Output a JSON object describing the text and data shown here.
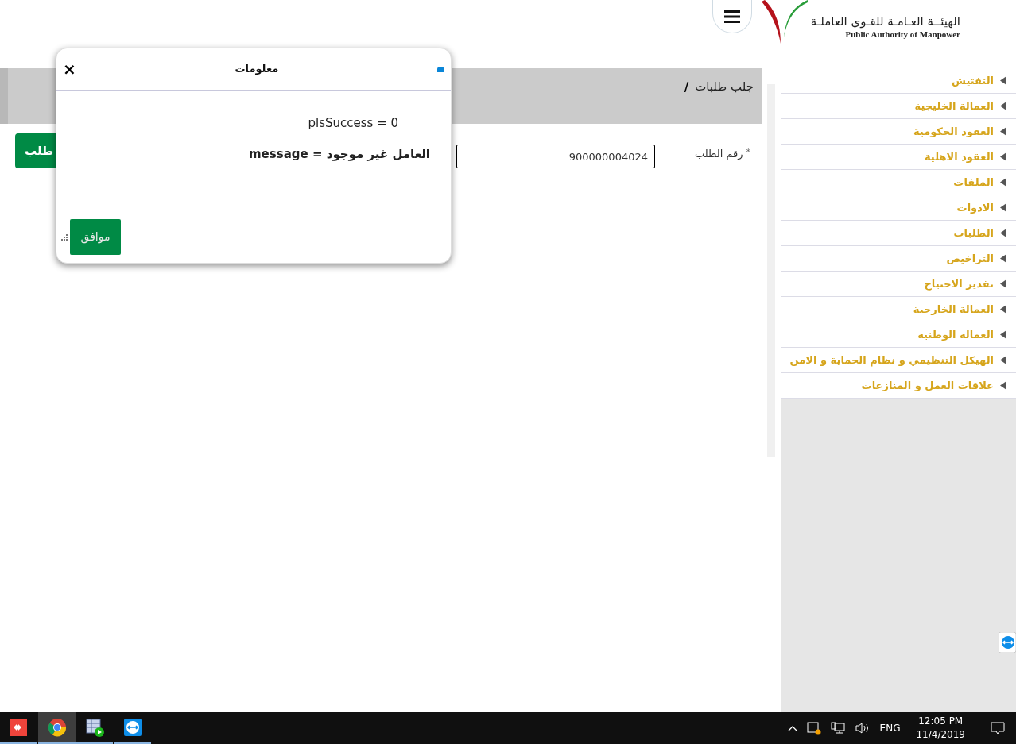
{
  "header": {
    "logo_arabic": "الهيئــة العـامـة للقـوى العاملـة",
    "logo_english": "Public Authority of Manpower"
  },
  "breadcrumb": {
    "title": "جلب طلبات",
    "separator": "/"
  },
  "form": {
    "label": "رقم الطلب",
    "required_mark": "*",
    "value": "900000004024",
    "button": "طلب"
  },
  "sidebar": {
    "items": [
      {
        "label": "التفتيش"
      },
      {
        "label": "العمالة الخليجية"
      },
      {
        "label": "العقود الحكومية"
      },
      {
        "label": "العقود الاهلية"
      },
      {
        "label": "الملفات"
      },
      {
        "label": "الادوات"
      },
      {
        "label": "الطلبات"
      },
      {
        "label": "التراخيص"
      },
      {
        "label": "تقدير الاحتياج"
      },
      {
        "label": "العمالة الخارجية"
      },
      {
        "label": "العمالة الوطنية"
      },
      {
        "label": "الهيكل التنظيمي و نظام الحماية و الامن"
      },
      {
        "label": "علاقات العمل و المنازعات"
      }
    ]
  },
  "dialog": {
    "title": "معلومات",
    "close": "×",
    "lines": [
      "plsSuccess = 0",
      "message = العامل غير موجود"
    ],
    "ok_button": "موافق"
  },
  "taskbar": {
    "time": "12:05 PM",
    "date": "11/4/2019",
    "language": "ENG",
    "apps": [
      {
        "selected": false
      },
      {
        "selected": true
      },
      {
        "selected": false
      },
      {
        "selected": false
      }
    ]
  }
}
